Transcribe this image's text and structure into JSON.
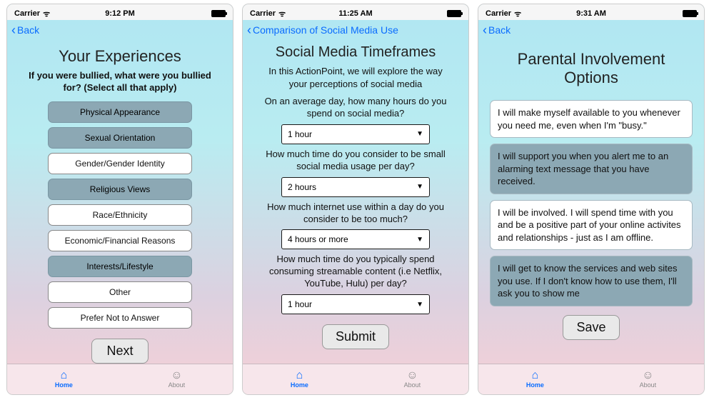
{
  "statusbar": {
    "carrier": "Carrier"
  },
  "nav": {
    "back": "Back"
  },
  "tabs": {
    "home": "Home",
    "about": "About"
  },
  "screen1": {
    "time": "9:12 PM",
    "title": "Your Experiences",
    "prompt": "If you were bullied, what were you bullied for? (Select all that apply)",
    "options": [
      {
        "label": "Physical Appearance",
        "selected": true
      },
      {
        "label": "Sexual Orientation",
        "selected": true
      },
      {
        "label": "Gender/Gender Identity",
        "selected": false
      },
      {
        "label": "Religious Views",
        "selected": true
      },
      {
        "label": "Race/Ethnicity",
        "selected": false
      },
      {
        "label": "Economic/Financial Reasons",
        "selected": false
      },
      {
        "label": "Interests/Lifestyle",
        "selected": true
      },
      {
        "label": "Other",
        "selected": false
      },
      {
        "label": "Prefer Not to Answer",
        "selected": false
      }
    ],
    "cta": "Next"
  },
  "screen2": {
    "time": "11:25 AM",
    "back": "Comparison of Social Media Use",
    "title": "Social Media Timeframes",
    "intro": "In this ActionPoint, we will explore the way your perceptions of social media",
    "q1": {
      "text": "On an average day, how many hours do you spend on social media?",
      "value": "1 hour"
    },
    "q2": {
      "text": "How much time do you consider to be small social media usage per day?",
      "value": "2 hours"
    },
    "q3": {
      "text": "How much internet use within a day do you consider to be too much?",
      "value": "4 hours or more"
    },
    "q4": {
      "text": "How much time do you typically spend consuming streamable content (i.e Netflix, YouTube, Hulu) per day?",
      "value": "1 hour"
    },
    "cta": "Submit"
  },
  "screen3": {
    "time": "9:31 AM",
    "title": "Parental Involvement Options",
    "cards": [
      {
        "text": "I will make myself available to you whenever you need me, even when I'm \"busy.\"",
        "selected": false
      },
      {
        "text": "I will support you when you alert me to an alarming text message that you have received.",
        "selected": true
      },
      {
        "text": "I will be involved. I will spend time with you and be a positive part of your online activites and relationships - just as I am offline.",
        "selected": false
      },
      {
        "text": "I will get to know the services and web sites you use. If I don't know how to use them, I'll ask you to show me",
        "selected": true
      }
    ],
    "cta": "Save"
  }
}
